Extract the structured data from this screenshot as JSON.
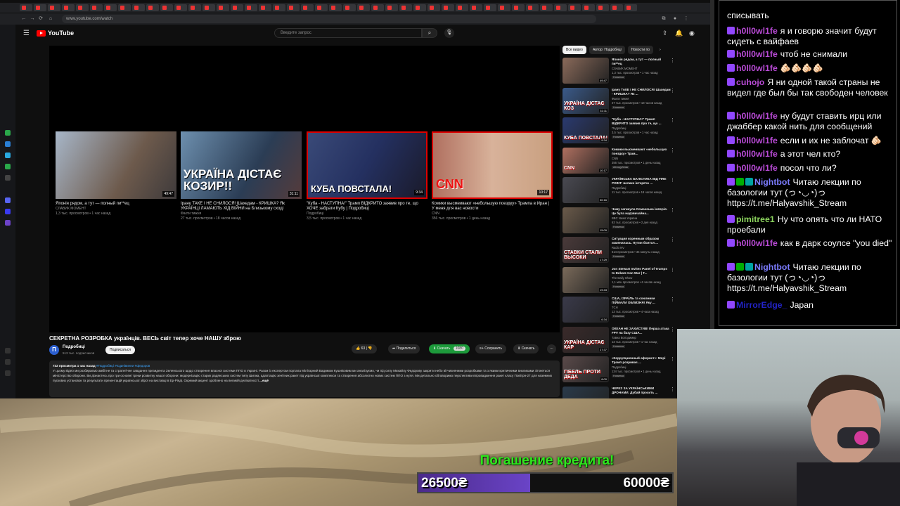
{
  "browser": {
    "url": "www.youtube.com/watch"
  },
  "youtube": {
    "logo_text": "YouTube",
    "search_placeholder": "Введите запрос",
    "endcards": [
      {
        "title": "Японія рядом, а тут — полный пи**ец",
        "channel": "СЛАВИК МОМЕНТ",
        "meta": "1,3 тыс. просмотров • 1 час назад",
        "duration": "49:47",
        "caption": ""
      },
      {
        "title": "Ірану ТАКЕ І НЕ СНИЛОСЯ! Шахедам - КРИШКА? Як УКРАЇНЦІ ЛАМАЮТЬ ХІД ВІЙНИ на Близькому сході",
        "channel": "Факти тижня",
        "meta": "27 тыс. просмотров • 18 часов назад",
        "duration": "31:11",
        "caption": "УКРАЇНА ДІСТАЄ КОЗИР!!"
      },
      {
        "title": "\"Куба - НАСТУПНА!\" Трамп ВІДКРИТО заявив про те, що ХОЧЕ забрати Кубу | Подробиці",
        "channel": "Подробиці",
        "meta": "3,5 тыс. просмотров • 1 час назад",
        "duration": "9:34",
        "caption": "КУБА ПОВСТАЛА!"
      },
      {
        "title": "Комики высмеивают «небольшую поездку» Трампа в Иран | У меня для вас новости",
        "channel": "CNN",
        "meta": "356 тыс. просмотров • 1 день назад",
        "duration": "10:17",
        "caption": "CNN"
      }
    ],
    "video": {
      "title": "СЕКРЕТНА РОЗРОБКА українців. ВЕСЬ світ тепер хоче НАШУ зброю",
      "channel": "Подробиці",
      "subscribers": "513 тыс. подписчиков",
      "subscribe_label": "Подписаться",
      "likes": "63",
      "share_label": "Поделиться",
      "download_label": "Скачать",
      "quality_label": "1080",
      "save_label": "Сохранить",
      "download2_label": "Скачать",
      "desc_stats": "732 просмотра  1 час назад",
      "desc_tags": "#Подробиці #Єдинівинни #федоров",
      "desc_text": "У цьому відео ми розбираємо амбітне та стратегічне завдання президента Зеленського щодо створення власної системи ППО в Україні. Разом із експертом портала Мілітарний Вадимом Кушніковим ми аналізуємо, чи під силу Михайлу Федорову закрити небо вітчизняними розробками та з якими критичними викликами зіткнеться міністерство оборони. Ви дізнаєтесь про три основні треки розвитку нашої оборони: модернізацію старих радянських систем типу Шилка, адаптацію зенітних ракет під українські комплекси та створення абсолютно нових систем ППО з нуля. Ми детально обговоримо перспективи впровадження ракет класу Повітря-27 для наземних пускових установок та результати презентацій української зброї на виставці в Ер-Ріяді. Окремий акцент зроблено на великій делікатності",
      "desc_more": "...ещё"
    },
    "chips": [
      "Все видео",
      "Автор: Подробиці",
      "Новости по"
    ],
    "related": [
      {
        "title": "Японія рядом, а тут — полный пи**ец",
        "channel": "СЛАВИК МОМЕНТ",
        "meta": "1,3 тыс. просмотров • 1 час назад",
        "badge": "Новинка",
        "duration": "49:47",
        "caption": ""
      },
      {
        "title": "Ірану ТАКЕ І НЕ СНИЛОСЯ! Шахедам - КРИШКА? Як ...",
        "channel": "Факти тижня",
        "meta": "27 тыс. просмотров • 18 часов назад",
        "badge": "Новинка",
        "duration": "31:11",
        "caption": "УКРАЇНА ДІСТАЄ КОЗ"
      },
      {
        "title": "\"Куба - НАСТУПНА!\" Трамп ВІДКРИТО заявив про те, що ...",
        "channel": "Подробиці",
        "meta": "3,5 тыс. просмотров • 1 час назад",
        "badge": "Новинка",
        "duration": "9:34",
        "caption": "КУБА ПОВСТАЛА!"
      },
      {
        "title": "Комики высмеивают «небольшую поездку» Трам...",
        "channel": "CNN",
        "meta": "356 тыс. просмотров • 1 день назад",
        "badge": "Автодубляж",
        "duration": "10:17",
        "caption": "CNN"
      },
      {
        "title": "УКРАЇНСЬКА БАЛІСТИКА ВІД FIRE POINT: велике інтерв'ю ...",
        "channel": "Подробиці",
        "meta": "11 тыс. просмотров • 18 часов назад",
        "badge": "",
        "duration": "30:16",
        "caption": ""
      },
      {
        "title": "Чому загинула Османська імперія. Це була надзвичайна...",
        "channel": "BBC News Україна",
        "meta": "63 тыс. просмотров • 2 дня назад",
        "badge": "Новинка",
        "duration": "15:09",
        "caption": ""
      },
      {
        "title": "Ситуация коренным образом изменилась. Путин боится ...",
        "channel": "Radio NV",
        "meta": "614 просмотров • 34 минуты назад",
        "badge": "Новинка",
        "duration": "17:29",
        "caption": "СТАВКИ СТАЛИ ВЫСОКИ"
      },
      {
        "title": "Jon Stewart Invites Panel of Trumps to Debate Iran War | T...",
        "channel": "The Daily Show",
        "meta": "1,1 млн просмотров • 6 часов назад",
        "badge": "Новинка",
        "duration": "19:43",
        "caption": ""
      },
      {
        "title": "США, ІЗРАЇЛЬ та союзники ПІЙМАЛИ ОБЛИЗНЯ! Яку ...",
        "channel": "ТСН",
        "meta": "13 тыс. просмотров • 4 часа назад",
        "badge": "Новинка",
        "duration": "6:34",
        "caption": ""
      },
      {
        "title": "ОКЕАН НЕ ЗАХИСТИВ! Перша атака FPV на базу США...",
        "channel": "Тавна Володимир",
        "meta": "13 тыс. просмотров • 1 час назад",
        "badge": "Новинка",
        "duration": "27:37",
        "caption": "УКРАЇНА ДІСТАЄ КАР"
      },
      {
        "title": "«Коррупционный аферист»: Мері Трамп розриває ...",
        "channel": "Подробиці",
        "meta": "134 тыс. просмотров • 1 день назад",
        "badge": "Новинка",
        "duration": "8:00",
        "caption": "ГІБЕЛЬ ПРОТИ ДЕДА"
      },
      {
        "title": "ЧЕРЕЗ ЗА УКРАЇНСЬКИМИ ДРОНАМИ. Дубай просить ...",
        "channel": "",
        "meta": "",
        "badge": "",
        "duration": "",
        "caption": ""
      }
    ]
  },
  "chat": {
    "messages": [
      {
        "user": "",
        "text": "списывать",
        "color": "#ffffff",
        "badges": []
      },
      {
        "user": "h0ll0wl1fe",
        "text": "я и говорю значит будут сидеть с вайфаев",
        "color": "#b94bd6",
        "badges": [
          "#9147ff"
        ]
      },
      {
        "user": "h0ll0wl1fe",
        "text": "чтоб не снимали",
        "color": "#b94bd6",
        "badges": [
          "#9147ff"
        ]
      },
      {
        "user": "h0ll0wl1fe",
        "text": "🫵🏻🫵🏻🫵🏻🫵🏻",
        "color": "#b94bd6",
        "badges": [
          "#9147ff"
        ]
      },
      {
        "user": "cuhojo",
        "text": "Я ни одной такой страны не видел где был бы так свободен человек",
        "color": "#b94bd6",
        "badges": [
          "#9147ff"
        ]
      },
      {
        "user": "h0ll0wl1fe",
        "text": "ну будут ставить ирц или джаббер какой нить для сообщений",
        "color": "#b94bd6",
        "badges": [
          "#9147ff"
        ]
      },
      {
        "user": "h0ll0wl1fe",
        "text": "если и их не заблочат 🫵🏻",
        "color": "#b94bd6",
        "badges": [
          "#9147ff"
        ]
      },
      {
        "user": "h0ll0wl1fe",
        "text": "а этот чел кто?",
        "color": "#b94bd6",
        "badges": [
          "#9147ff"
        ]
      },
      {
        "user": "h0ll0wl1fe",
        "text": "посол что ли?",
        "color": "#b94bd6",
        "badges": [
          "#9147ff"
        ]
      },
      {
        "user": "Nightbot",
        "text": "Читаю лекции по базологии тут (っ◔◡◔)っ https://t.me/Halyavshik_Stream",
        "color": "#7c7cff",
        "badges": [
          "#9147ff",
          "#00ad03",
          "#00a3a3"
        ]
      },
      {
        "user": "pimitree1",
        "text": "Ну что опять что ли НАТО проебали",
        "color": "#8bd35d",
        "badges": [
          "#9147ff"
        ]
      },
      {
        "user": "h0ll0wl1fe",
        "text": "как в дарк соулсе \"you died\"",
        "color": "#b94bd6",
        "badges": [
          "#9147ff"
        ]
      },
      {
        "user": "Nightbot",
        "text": "Читаю лекции по базологии тут (っ◔◡◔)っ https://t.me/Halyavshik_Stream",
        "color": "#7c7cff",
        "badges": [
          "#9147ff",
          "#00ad03",
          "#00a3a3"
        ]
      },
      {
        "user": "MirrorEdge_",
        "text": "Japan",
        "color": "#2323c8",
        "badges": [
          "#9147ff"
        ]
      }
    ]
  },
  "overlay": {
    "credit_label": "Погашение кредита!",
    "credit_current": "26500₴",
    "credit_goal": "60000₴",
    "credit_progress": 0.44,
    "accent_green": "#2ee81c",
    "accent_purple": "#6a44c7"
  }
}
